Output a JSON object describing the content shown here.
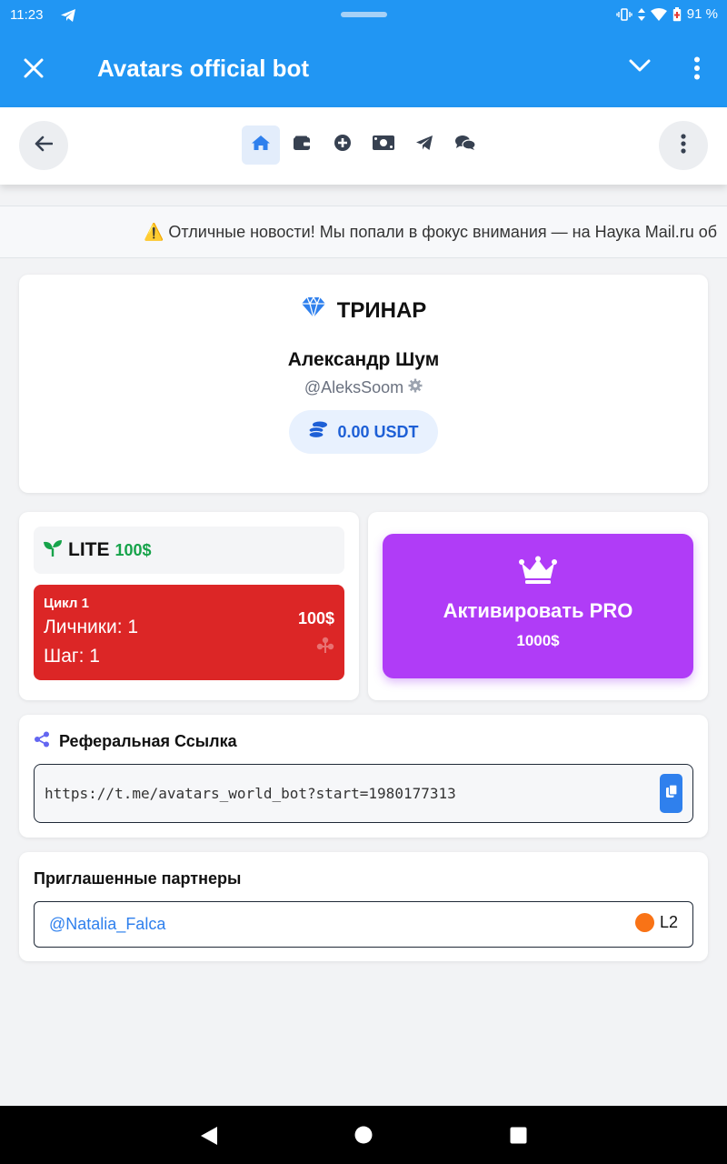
{
  "status_bar": {
    "time": "11:23",
    "battery": "91 %"
  },
  "app_bar": {
    "title": "Avatars official bot"
  },
  "ticker": {
    "text": "⚠️ Отличные новости! Мы попали в фокус внимания — на Наука Mail.ru об"
  },
  "profile": {
    "brand": "ТРИНАР",
    "name": "Александр Шум",
    "username": "@AleksSoom",
    "balance": "0.00 USDT"
  },
  "lite": {
    "name": "LITE",
    "price": "100$",
    "cycle_title": "Цикл 1",
    "personal": "Личники: 1",
    "step": "Шаг: 1",
    "amount": "100$"
  },
  "pro": {
    "label": "Активировать PRO",
    "price": "1000$"
  },
  "referral": {
    "title": "Реферальная Ссылка",
    "url": "https://t.me/avatars_world_bot?start=1980177313"
  },
  "partners": {
    "title": "Приглашенные партнеры",
    "items": [
      {
        "username": "@Natalia_Falca",
        "level": "L2"
      }
    ]
  },
  "colors": {
    "app_bar": "#2196f3",
    "lite_cycle": "#dc2626",
    "pro": "#b03cf7",
    "accent_blue": "#2f80ed",
    "lite_price": "#16a34a",
    "partner_level_dot": "#f97316"
  },
  "icons": {
    "nav": [
      "home-icon",
      "wallet-icon",
      "plus-circle-icon",
      "money-icon",
      "send-icon",
      "chat-icon"
    ],
    "brand": "gem-icon",
    "balance": "coins-icon",
    "lite": "seedling-icon",
    "pro": "crown-icon",
    "referral": "share-icon",
    "copy": "copy-icon"
  }
}
